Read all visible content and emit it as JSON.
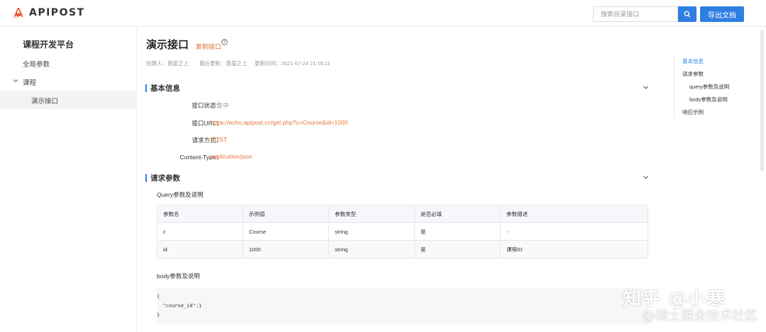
{
  "header": {
    "logo_text": "APIPOST",
    "search_placeholder": "搜索目录接口",
    "export_label": "导出文档"
  },
  "sidebar": {
    "title": "课程开发平台",
    "items": [
      {
        "label": "全局参数"
      },
      {
        "label": "课程"
      },
      {
        "label": "演示接口"
      }
    ]
  },
  "main": {
    "title": "演示接口",
    "copy_label": "复制接口",
    "meta": {
      "creator": "创建人：悬崖之上",
      "updater": "最后更新：悬崖之上",
      "updated_time": "更新时间：2021-07-24 21:18:11"
    },
    "basic": {
      "title": "基本信息",
      "status_label": "接口状态：",
      "status_value": "开发中",
      "url_label": "接口URL：",
      "url_value": "https://echo.apipost.cn/get.php?c=Course&id=1000",
      "method_label": "请求方式：",
      "method_value": "POST",
      "content_type_label": "Content-Type：",
      "content_type_value": "application/json"
    },
    "request": {
      "title": "请求参数",
      "query_title": "Query参数及说明",
      "columns": [
        "参数名",
        "示例值",
        "参数类型",
        "是否必填",
        "参数描述"
      ],
      "rows": [
        [
          "c",
          "Course",
          "string",
          "是",
          "-"
        ],
        [
          "id",
          "1000",
          "string",
          "是",
          "课程ID"
        ]
      ],
      "body_title": "body参数及说明",
      "body_lines": [
        "{",
        "  \"course_id\":1",
        "}"
      ]
    }
  },
  "toc": {
    "items": [
      {
        "label": "基本信息"
      },
      {
        "label": "请求参数"
      },
      {
        "label": "query参数及说明"
      },
      {
        "label": "body参数及说明"
      },
      {
        "label": "响应示例"
      }
    ]
  },
  "watermark": {
    "line1": "知乎 @小寒",
    "line2": "@稀土掘金技术社区"
  },
  "colors": {
    "accent": "#2f7fe3",
    "link_orange": "#e4763a"
  }
}
